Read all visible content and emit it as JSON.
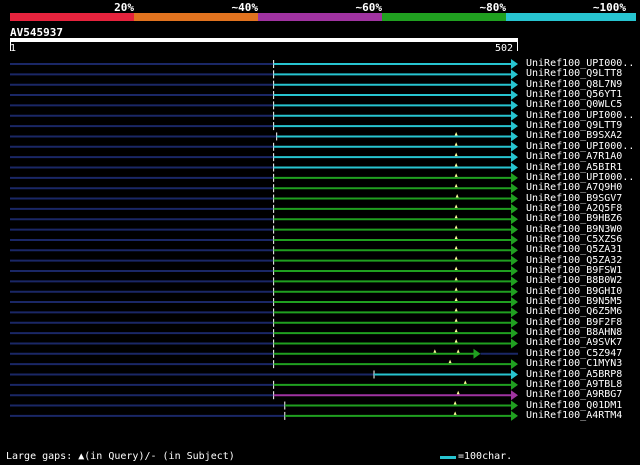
{
  "scale": {
    "segments": [
      {
        "label": "20%",
        "color": "#e6233d"
      },
      {
        "label": "~40%",
        "color": "#e1731f"
      },
      {
        "label": "~60%",
        "color": "#a033a1"
      },
      {
        "label": "~80%",
        "color": "#20a020"
      },
      {
        "label": "~100%",
        "color": "#27c4d0"
      }
    ]
  },
  "query": {
    "name": "AV545937",
    "start": "1",
    "end": "502",
    "length": 502
  },
  "colors": {
    "background": "#000000",
    "unaligned_line": "#1a2766",
    "gap_marker": "#ffff99",
    "cyan": "#27c4d0",
    "green": "#20a020",
    "purple": "#a033a1"
  },
  "hits": [
    {
      "name": "UniRef100_UPI000..",
      "start": 261,
      "end": 502,
      "identity": "cyan",
      "gaps": []
    },
    {
      "name": "UniRef100_Q9LTT8",
      "start": 261,
      "end": 502,
      "identity": "cyan",
      "gaps": []
    },
    {
      "name": "UniRef100_Q8L7N9",
      "start": 261,
      "end": 502,
      "identity": "cyan",
      "gaps": []
    },
    {
      "name": "UniRef100_Q56YT1",
      "start": 261,
      "end": 502,
      "identity": "cyan",
      "gaps": []
    },
    {
      "name": "UniRef100_Q0WLC5",
      "start": 261,
      "end": 502,
      "identity": "cyan",
      "gaps": []
    },
    {
      "name": "UniRef100_UPI000..",
      "start": 261,
      "end": 502,
      "identity": "cyan",
      "gaps": []
    },
    {
      "name": "UniRef100_Q9LTT9",
      "start": 261,
      "end": 502,
      "identity": "cyan",
      "gaps": []
    },
    {
      "name": "UniRef100_B9SXA2",
      "start": 264,
      "end": 502,
      "identity": "cyan",
      "gaps": [
        441
      ]
    },
    {
      "name": "UniRef100_UPI000..",
      "start": 261,
      "end": 502,
      "identity": "cyan",
      "gaps": [
        441
      ]
    },
    {
      "name": "UniRef100_A7R1A0",
      "start": 261,
      "end": 502,
      "identity": "cyan",
      "gaps": [
        441
      ]
    },
    {
      "name": "UniRef100_A5BIR1",
      "start": 261,
      "end": 502,
      "identity": "cyan",
      "gaps": [
        441
      ]
    },
    {
      "name": "UniRef100_UPI000..",
      "start": 261,
      "end": 502,
      "identity": "green",
      "gaps": [
        441
      ]
    },
    {
      "name": "UniRef100_A7Q9H0",
      "start": 261,
      "end": 502,
      "identity": "green",
      "gaps": [
        441
      ]
    },
    {
      "name": "UniRef100_B9SGV7",
      "start": 261,
      "end": 502,
      "identity": "green",
      "gaps": [
        442
      ]
    },
    {
      "name": "UniRef100_A2Q5F8",
      "start": 261,
      "end": 502,
      "identity": "green",
      "gaps": [
        441
      ]
    },
    {
      "name": "UniRef100_B9HBZ6",
      "start": 261,
      "end": 502,
      "identity": "green",
      "gaps": [
        441
      ]
    },
    {
      "name": "UniRef100_B9N3W0",
      "start": 261,
      "end": 502,
      "identity": "green",
      "gaps": [
        441
      ]
    },
    {
      "name": "UniRef100_C5XZS6",
      "start": 261,
      "end": 502,
      "identity": "green",
      "gaps": [
        441
      ]
    },
    {
      "name": "UniRef100_Q5ZA31",
      "start": 261,
      "end": 502,
      "identity": "green",
      "gaps": [
        441
      ]
    },
    {
      "name": "UniRef100_Q5ZA32",
      "start": 261,
      "end": 502,
      "identity": "green",
      "gaps": [
        441
      ]
    },
    {
      "name": "UniRef100_B9FSW1",
      "start": 261,
      "end": 502,
      "identity": "green",
      "gaps": [
        441
      ]
    },
    {
      "name": "UniRef100_B8B0W2",
      "start": 261,
      "end": 502,
      "identity": "green",
      "gaps": [
        441
      ]
    },
    {
      "name": "UniRef100_B9GHI0",
      "start": 261,
      "end": 502,
      "identity": "green",
      "gaps": [
        441
      ]
    },
    {
      "name": "UniRef100_B9N5M5",
      "start": 261,
      "end": 502,
      "identity": "green",
      "gaps": [
        441
      ]
    },
    {
      "name": "UniRef100_Q6Z5M6",
      "start": 261,
      "end": 502,
      "identity": "green",
      "gaps": [
        441
      ]
    },
    {
      "name": "UniRef100_B9F2F8",
      "start": 261,
      "end": 502,
      "identity": "green",
      "gaps": [
        441
      ]
    },
    {
      "name": "UniRef100_B8AHN8",
      "start": 261,
      "end": 502,
      "identity": "green",
      "gaps": [
        441
      ]
    },
    {
      "name": "UniRef100_A9SVK7",
      "start": 261,
      "end": 502,
      "identity": "green",
      "gaps": [
        441
      ]
    },
    {
      "name": "UniRef100_C5Z947",
      "start": 261,
      "end": 465,
      "identity": "green",
      "gaps": [
        420,
        443
      ]
    },
    {
      "name": "UniRef100_C1MYN3",
      "start": 261,
      "end": 502,
      "identity": "green",
      "gaps": [
        435
      ]
    },
    {
      "name": "UniRef100_A5BRP8",
      "start": 360,
      "end": 502,
      "identity": "cyan",
      "gaps": []
    },
    {
      "name": "UniRef100_A9TBL8",
      "start": 261,
      "end": 502,
      "identity": "green",
      "gaps": [
        450
      ]
    },
    {
      "name": "UniRef100_A9RBG7",
      "start": 261,
      "end": 502,
      "identity": "purple",
      "gaps": [
        443
      ]
    },
    {
      "name": "UniRef100_Q01DM1",
      "start": 272,
      "end": 502,
      "identity": "green",
      "gaps": [
        440
      ]
    },
    {
      "name": "UniRef100_A4RTM4",
      "start": 272,
      "end": 502,
      "identity": "green",
      "gaps": [
        440
      ]
    }
  ],
  "legend": {
    "text": "Large gaps: ▲(in Query)/- (in Subject)",
    "swatch_label": "=100char."
  }
}
